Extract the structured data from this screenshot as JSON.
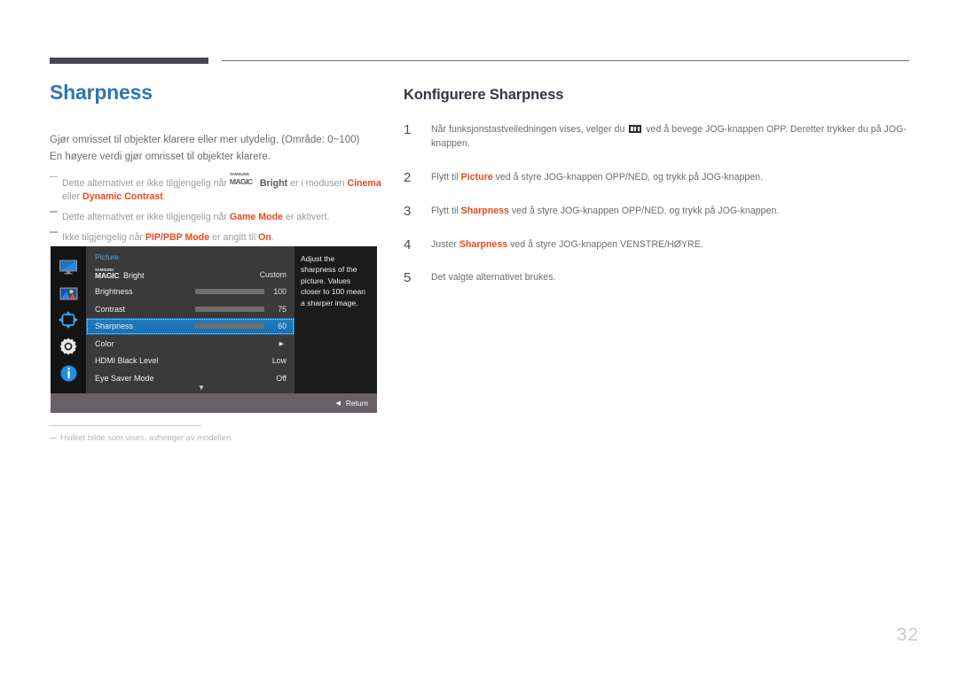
{
  "page": {
    "number": "32"
  },
  "left": {
    "title": "Sharpness",
    "desc_line1": "Gjør omrisset til objekter klarere eller mer utydelig. (Område: 0~100)",
    "desc_line2": "En høyere verdi gjør omrisset til objekter klarere.",
    "notes": [
      {
        "pre": "Dette alternativet er ikke tilgjengelig når ",
        "magic_small": "SAMSUNG",
        "magic_big": "MAGIC",
        "magic_suffix": "Bright",
        "mid": " er i modusen ",
        "hl1": "Cinema",
        "mid2": " eller ",
        "hl2": "Dynamic Contrast",
        "post": "."
      },
      {
        "pre": "Dette alternativet er ikke tilgjengelig når ",
        "hl1": "Game Mode",
        "post": " er aktivert."
      },
      {
        "pre": "Ikke tilgjengelig når ",
        "hl1": "PIP/PBP Mode",
        "mid": " er angitt til ",
        "hl2": "On",
        "post": "."
      }
    ],
    "footnote": "Hvilket bilde som vises, avhenger av modellen."
  },
  "osd": {
    "panel_title": "Picture",
    "sidebar_icons": [
      "monitor-icon",
      "picture-icon",
      "pip-arrows-icon",
      "gear-icon",
      "info-icon"
    ],
    "rows": [
      {
        "type": "magic",
        "label_small": "SAMSUNG",
        "label_big": "MAGIC",
        "label_suffix": "Bright",
        "value": "Custom",
        "selected": false
      },
      {
        "type": "slider",
        "label": "Brightness",
        "value": "100",
        "fill_percent": 100,
        "selected": false
      },
      {
        "type": "slider",
        "label": "Contrast",
        "value": "75",
        "fill_percent": 75,
        "selected": false
      },
      {
        "type": "slider",
        "label": "Sharpness",
        "value": "60",
        "fill_percent": 60,
        "selected": true
      },
      {
        "type": "submenu",
        "label": "Color",
        "value": "▶",
        "selected": false
      },
      {
        "type": "value",
        "label": "HDMI Black Level",
        "value": "Low",
        "selected": false
      },
      {
        "type": "value",
        "label": "Eye Saver Mode",
        "value": "Off",
        "selected": false
      }
    ],
    "scroll_down_indicator": "▼",
    "tooltip": "Adjust the sharpness of the picture. Values closer to 100 mean a sharper image.",
    "return_label": "Return",
    "return_arrow": "◀",
    "colors": {
      "selected_row": "#1f7ec4",
      "panel_title": "#4fa8e0",
      "panel_bg": "#3a3a3a",
      "sidebar_bg": "#141414",
      "bottom_bar": "#6a6068"
    }
  },
  "right": {
    "section_title": "Konfigurere Sharpness",
    "steps": [
      {
        "num": "1",
        "pre": "Når funksjonstastveiledningen vises, velger du ",
        "glyph": "menu-icon",
        "post": " ved å bevege JOG-knappen OPP. Deretter trykker du på JOG-knappen."
      },
      {
        "num": "2",
        "pre": "Flytt til ",
        "hl": "Picture",
        "post": " ved å styre JOG-knappen OPP/NED, og trykk på JOG-knappen."
      },
      {
        "num": "3",
        "pre": "Flytt til ",
        "hl": "Sharpness",
        "post": " ved å styre JOG-knappen OPP/NED, og trykk på JOG-knappen."
      },
      {
        "num": "4",
        "pre": "Juster ",
        "hl": "Sharpness",
        "post": " ved å styre JOG-knappen VENSTRE/HØYRE."
      },
      {
        "num": "5",
        "pre": "Det valgte alternativet brukes.",
        "hl": "",
        "post": ""
      }
    ]
  },
  "theme": {
    "heading_blue": "#2e75b6",
    "accent_orange": "#e8491d",
    "header_bar": "#484359",
    "section_title": "#3b3146"
  }
}
